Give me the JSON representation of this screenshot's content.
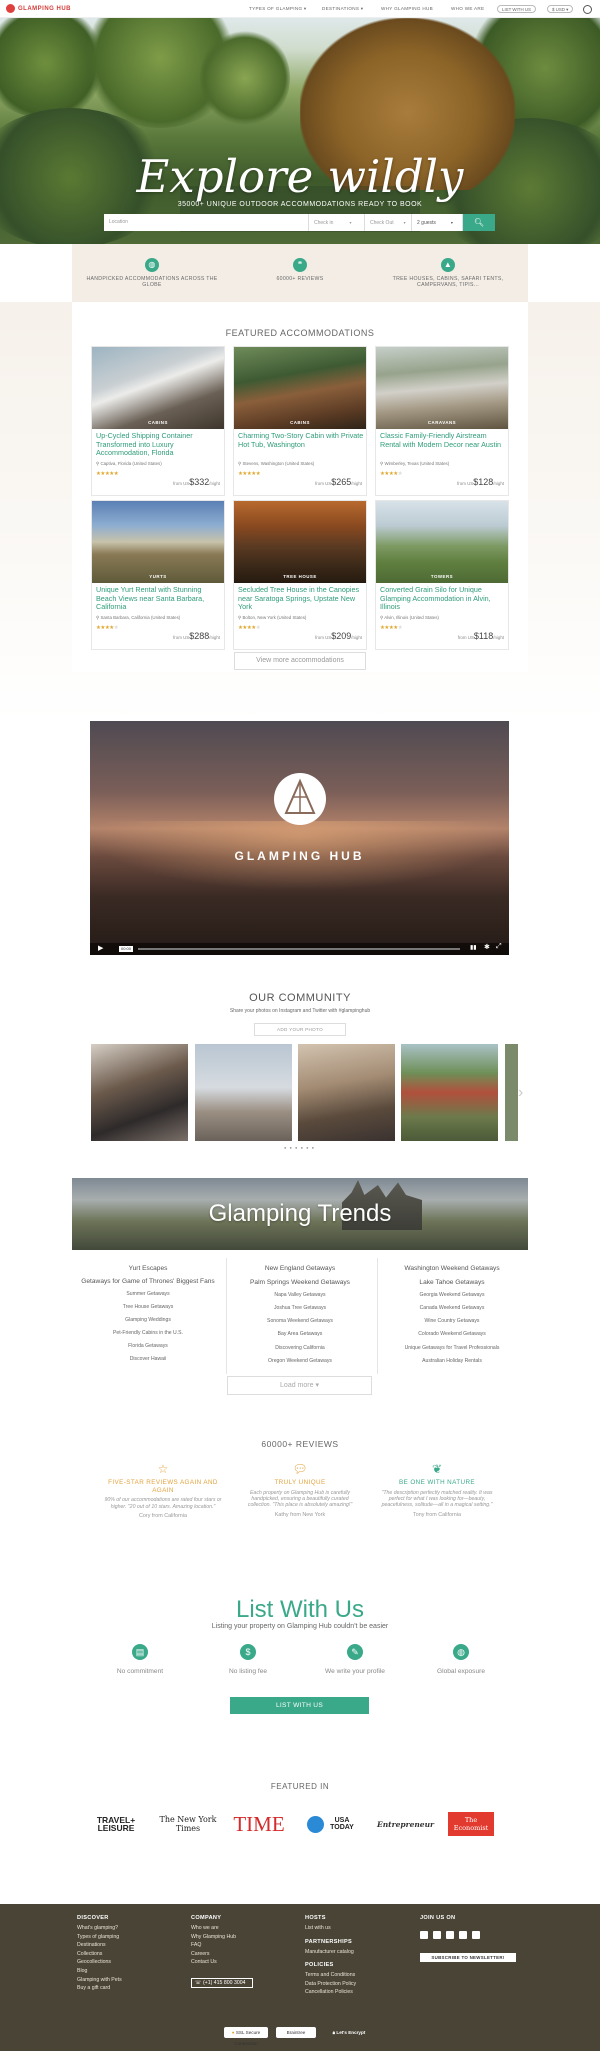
{
  "header": {
    "logo": "GLAMPING HUB",
    "nav": [
      "TYPES OF GLAMPING ▾",
      "DESTINATIONS ▾",
      "WHY GLAMPING HUB",
      "WHO WE ARE"
    ],
    "list_btn": "LIST WITH US",
    "currency": "$ USD ▾"
  },
  "hero": {
    "title": "Explore wildly",
    "subtitle": "35000+ UNIQUE OUTDOOR ACCOMMODATIONS READY TO BOOK",
    "location_placeholder": "Location",
    "checkin": "Check in",
    "checkout": "Check Out",
    "guests": "2 guests",
    "search_icon": "search-icon"
  },
  "features": [
    {
      "icon": "globe-icon",
      "text": "HANDPICKED ACCOMMODATIONS ACROSS THE GLOBE"
    },
    {
      "icon": "speech-icon",
      "text": "60000+ REVIEWS"
    },
    {
      "icon": "tent-icon",
      "text": "TREE HOUSES, CABINS, SAFARI TENTS, CAMPERVANS, TIPIS..."
    }
  ],
  "featured": {
    "heading": "FEATURED ACCOMMODATIONS",
    "view_more": "View more accommodations",
    "cards": [
      {
        "tag": "CABINS",
        "title": "Up-Cycled Shipping Container Transformed into Luxury Accommodation, Florida",
        "loc": "Captiva, Florida (United States)",
        "rating": 5,
        "from": "from",
        "cur": "US",
        "price": "$332",
        "per": "/night"
      },
      {
        "tag": "CABINS",
        "title": "Charming Two-Story Cabin with Private Hot Tub, Washington",
        "loc": "Stevens, Washington (United States)",
        "rating": 5,
        "from": "from",
        "cur": "US",
        "price": "$265",
        "per": "/night"
      },
      {
        "tag": "CARAVANS",
        "title": "Classic Family-Friendly Airstream Rental with Modern Decor near Austin",
        "loc": "Wimberley, Texas (United States)",
        "rating": 4,
        "from": "from",
        "cur": "US",
        "price": "$128",
        "per": "/night"
      },
      {
        "tag": "YURTS",
        "title": "Unique Yurt Rental with Stunning Beach Views near Santa Barbara, California",
        "loc": "Santa Barbara, California (United States)",
        "rating": 4,
        "from": "from",
        "cur": "US",
        "price": "$288",
        "per": "/night"
      },
      {
        "tag": "TREE HOUSE",
        "title": "Secluded Tree House in the Canopies near Saratoga Springs, Upstate New York",
        "loc": "Bolton, New York (United States)",
        "rating": 4,
        "from": "from",
        "cur": "US",
        "price": "$209",
        "per": "/night"
      },
      {
        "tag": "TOWERS",
        "title": "Converted Grain Silo for Unique Glamping Accommodation in Alvin, Illinois",
        "loc": "Alvin, Illinois (United States)",
        "rating": 4,
        "from": "from",
        "cur": "US",
        "price": "$118",
        "per": "/night"
      }
    ]
  },
  "video": {
    "brand": "GLAMPING HUB",
    "time": "00:00"
  },
  "community": {
    "heading": "OUR COMMUNITY",
    "sub": "Share your photos on Instagram and Twitter with #glampinghub",
    "add": "ADD YOUR PHOTO"
  },
  "trends": {
    "heading": "Glamping Trends",
    "columns": [
      [
        "Yurt Escapes",
        "Getaways for Game of Thrones' Biggest Fans",
        "Summer Getaways",
        "Tree House Getaways",
        "Glamping Weddings",
        "Pet-Friendly Cabins in the U.S.",
        "Florida Getaways",
        "Discover Hawaii"
      ],
      [
        "New England Getaways",
        "Palm Springs Weekend Getaways",
        "Napa Valley Getaways",
        "Joshua Tree Getaways",
        "Sonoma Weekend Getaways",
        "Bay Area Getaways",
        "Discovering California",
        "Oregon Weekend Getaways"
      ],
      [
        "Washington Weekend Getaways",
        "Lake Tahoe Getaways",
        "Georgia Weekend Getaways",
        "Canada Weekend Getaways",
        "Wine Country Getaways",
        "Colorado Weekend Getaways",
        "Unique Getaways for Travel Professionals",
        "Australian Holiday Rentals"
      ]
    ],
    "load_more": "Load more ▾"
  },
  "reviews": {
    "heading": "60000+ REVIEWS",
    "items": [
      {
        "icon": "star-icon",
        "head": "FIVE-STAR REVIEWS AGAIN AND AGAIN",
        "quote": "90% of our accommodations are rated four stars or higher. \"20 out of 10 stars. Amazing location.\"",
        "author": "Cory from California",
        "color": "#e4a23c"
      },
      {
        "icon": "speech-icon",
        "head": "TRULY UNIQUE",
        "quote": "Each property on Glamping Hub is carefully handpicked, ensuring a beautifully curated collection. \"This place is absolutely amazing!\"",
        "author": "Kathy from New York",
        "color": "#e4a23c"
      },
      {
        "icon": "leaf-icon",
        "head": "BE ONE WITH NATURE",
        "quote": "\"The description perfectly matched reality. It was perfect for what I was looking for—beauty, peacefulness, solitude—all in a magical setting.\"",
        "author": "Tony from California",
        "color": "#3aa989"
      }
    ]
  },
  "list": {
    "heading": "List With Us",
    "sub": "Listing your property on Glamping Hub couldn't be easier",
    "items": [
      "No commitment",
      "No listing fee",
      "We write your profile",
      "Global exposure"
    ],
    "button": "LIST WITH US"
  },
  "featured_in": {
    "heading": "FEATURED IN",
    "logos": [
      "TRAVEL+ LEISURE",
      "The New York Times",
      "TIME",
      "USA TODAY",
      "Entrepreneur",
      "The Economist"
    ]
  },
  "footer": {
    "cols": [
      {
        "head": "DISCOVER",
        "links": [
          "What's glamping?",
          "Types of glamping",
          "Destinations",
          "Collections",
          "Geocollections",
          "Blog",
          "Glamping with Pets",
          "Buy a gift card"
        ]
      },
      {
        "head": "COMPANY",
        "links": [
          "Who we are",
          "Why Glamping Hub",
          "FAQ",
          "Careers",
          "Contact Us"
        ],
        "phone": "(+1) 415 800 3004"
      },
      {
        "head": "HOSTS",
        "links": [
          "List with us"
        ],
        "head2": "PARTNERSHIPS",
        "links2": [
          "Manufacturer catalog"
        ],
        "head3": "POLICIES",
        "links3": [
          "Terms and Conditions",
          "Data Protection Policy",
          "Cancellation Policies"
        ]
      },
      {
        "head": "JOIN US ON",
        "newsletter": "SUBSCRIBE TO NEWSLETTER!"
      }
    ],
    "badges": [
      "SSL Secure Connection",
      "Braintree",
      "Let's Encrypt"
    ]
  }
}
